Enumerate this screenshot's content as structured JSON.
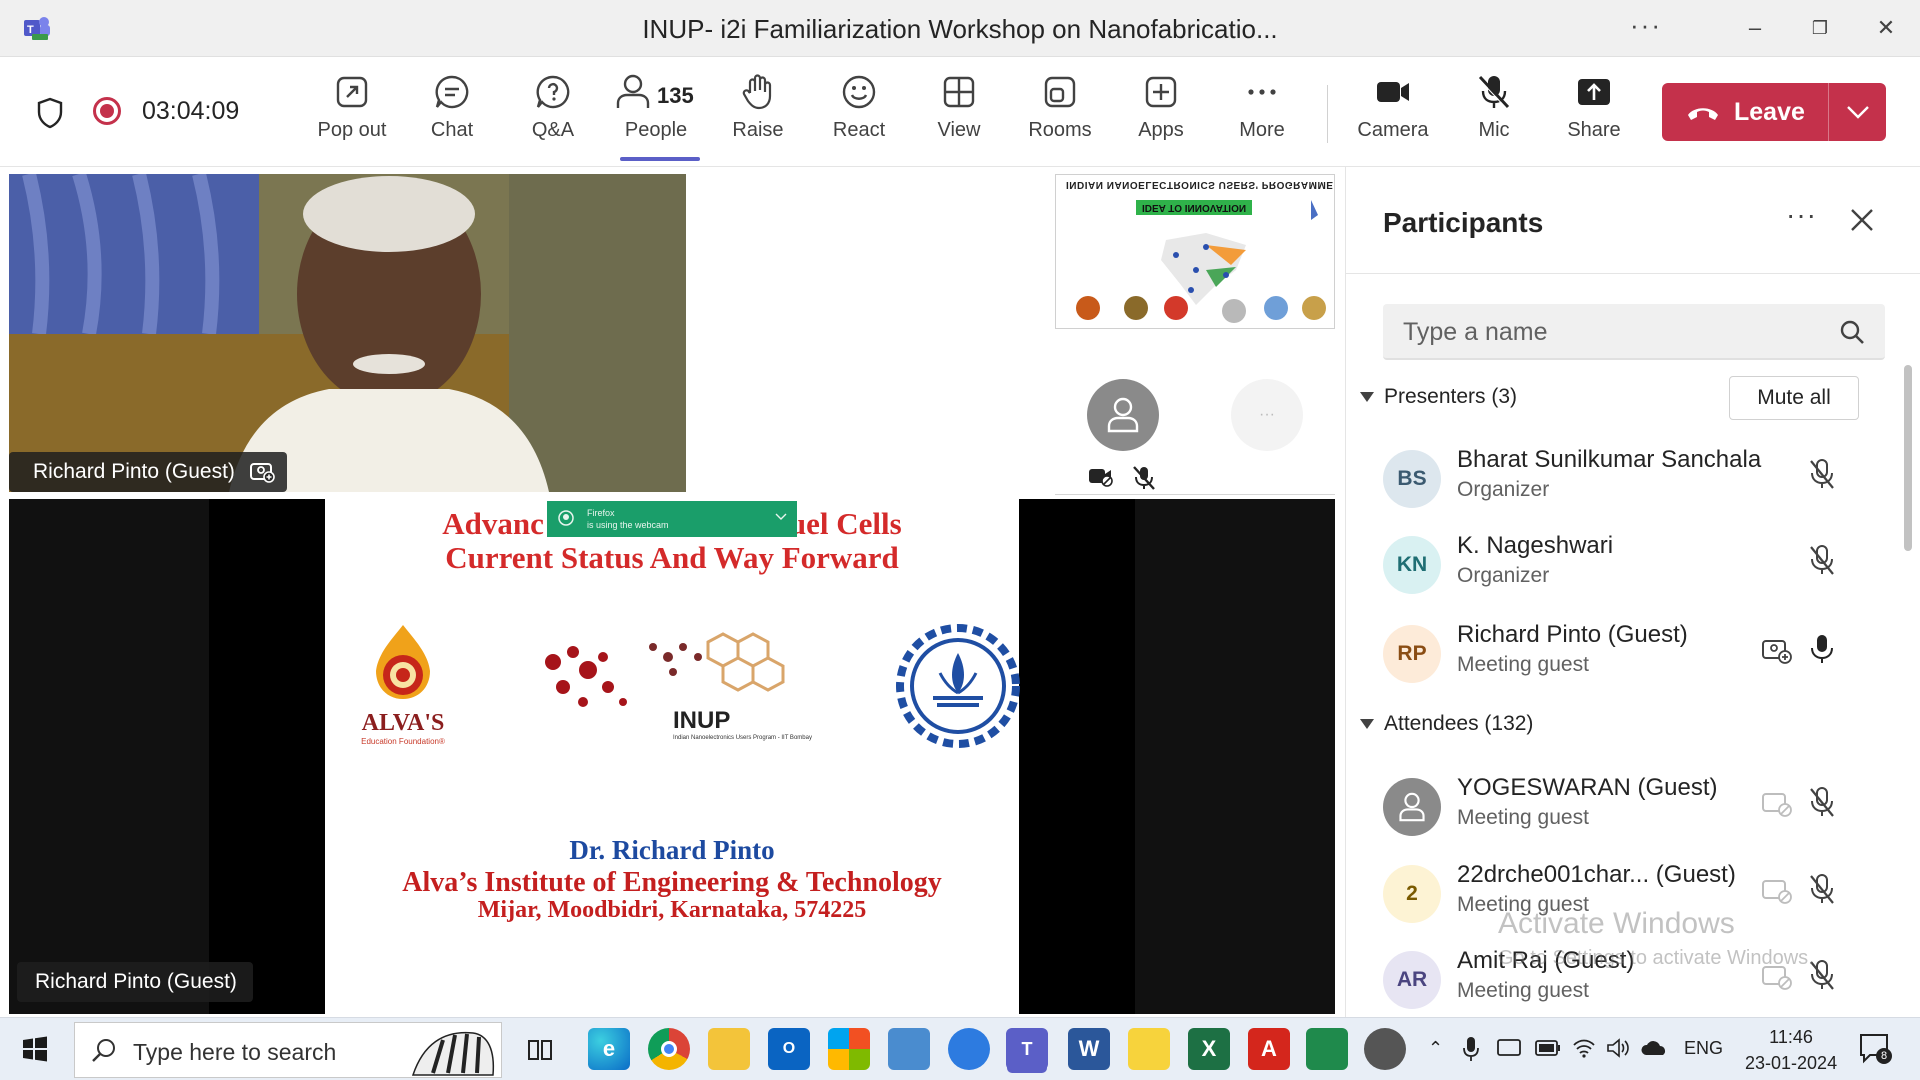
{
  "window": {
    "title": "INUP- i2i Familiarization Workshop on Nanofabricatio...",
    "more": "···",
    "minimize": "–",
    "restore": "❐",
    "close": "✕"
  },
  "toolbar": {
    "timer": "03:04:09",
    "people_count": "135",
    "items": [
      {
        "label": "Pop out",
        "icon": "pop-out-icon"
      },
      {
        "label": "Chat",
        "icon": "chat-icon"
      },
      {
        "label": "Q&A",
        "icon": "qa-icon"
      },
      {
        "label": "People",
        "icon": "people-icon"
      },
      {
        "label": "Raise",
        "icon": "raise-hand-icon"
      },
      {
        "label": "React",
        "icon": "react-icon"
      },
      {
        "label": "View",
        "icon": "view-icon"
      },
      {
        "label": "Rooms",
        "icon": "rooms-icon"
      },
      {
        "label": "Apps",
        "icon": "apps-icon"
      },
      {
        "label": "More",
        "icon": "more-icon"
      },
      {
        "label": "Camera",
        "icon": "camera-icon"
      },
      {
        "label": "Mic",
        "icon": "mic-off-icon"
      },
      {
        "label": "Share",
        "icon": "share-icon"
      }
    ],
    "leave_label": "Leave",
    "leave_color": "#c4314b",
    "accent": "#5b5fc7"
  },
  "stage": {
    "top_video_name": "Richard Pinto (Guest)",
    "main_video_name": "Richard Pinto (Guest)",
    "thumb_title": "INDIAN NANOELECTRONICS USERS' PROGRAMME",
    "thumb_sub": "IDEA TO INNOVATION",
    "more_tile": "···",
    "slide": {
      "title_line1": "Advanc",
      "title_line1_end": "uel Cells",
      "title_line2": "Current Status And Way Forward",
      "firefox_line1": "Firefox",
      "firefox_line2": "is using the webcam",
      "alvas": "ALVA'S",
      "alvas_sub": "Education Foundation®",
      "inup": "INUP",
      "inup_sub": "Indian Nanoelectronics Users Program - IIT Bombay",
      "presenter": "Dr. Richard Pinto",
      "institute": "Alva’s Institute of Engineering & Technology",
      "address": "Mijar, Moodbidri, Karnataka, 574225"
    }
  },
  "panel": {
    "title": "Participants",
    "more": "···",
    "search_placeholder": "Type a name",
    "presenters_label": "Presenters (3)",
    "mute_all": "Mute all",
    "attendees_label": "Attendees (132)",
    "presenters": [
      {
        "initials": "BS",
        "name": "Bharat Sunilkumar Sanchala",
        "role": "Organizer",
        "bg": "#dde7ee",
        "fg": "#3b5a70"
      },
      {
        "initials": "KN",
        "name": "K. Nageshwari",
        "role": "Organizer",
        "bg": "#d9f1f2",
        "fg": "#1f6e73"
      },
      {
        "initials": "RP",
        "name": "Richard Pinto (Guest)",
        "role": "Meeting guest",
        "bg": "#fdebd9",
        "fg": "#8a4d14"
      }
    ],
    "attendees": [
      {
        "initials": "",
        "name": "YOGESWARAN (Guest)",
        "role": "Meeting guest",
        "bg": "#8a8a8a",
        "fg": "#fff"
      },
      {
        "initials": "2",
        "name": "22drche001char...  (Guest)",
        "role": "Meeting guest",
        "bg": "#fdf3d4",
        "fg": "#7a5a00"
      },
      {
        "initials": "AR",
        "name": "Amit Raj (Guest)",
        "role": "Meeting guest",
        "bg": "#e7e5f3",
        "fg": "#4b4580"
      }
    ],
    "watermark_title": "Activate Windows",
    "watermark_sub": "Go to Settings to activate Windows."
  },
  "taskbar": {
    "search_placeholder": "Type here to search",
    "language": "ENG",
    "time": "11:46",
    "date": "23-01-2024",
    "notification_count": "8",
    "apps": [
      "task-view",
      "edge",
      "chrome",
      "file-explorer",
      "outlook-new",
      "microsoft-store",
      "control-panel",
      "app-blue",
      "teams",
      "word",
      "sticky-notes",
      "excel",
      "acrobat",
      "app-green",
      "clock-app"
    ]
  }
}
